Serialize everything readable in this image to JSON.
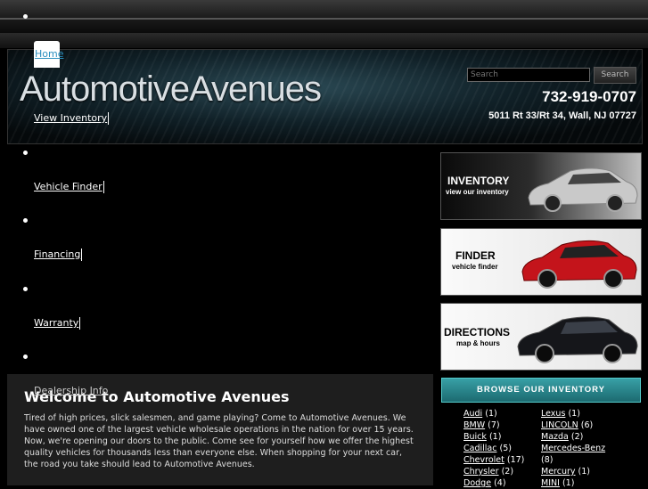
{
  "nav": {
    "items": [
      {
        "label": "Home"
      },
      {
        "label": "View Inventory"
      },
      {
        "label": "Vehicle Finder"
      },
      {
        "label": "Financing"
      },
      {
        "label": "Warranty"
      },
      {
        "label": "Dealership Info"
      }
    ]
  },
  "header": {
    "logo_text": "AutomotiveAvenues",
    "search_placeholder": "Search",
    "search_button": "Search",
    "phone": "732-919-0707",
    "address": "5011 Rt 33/Rt 34, Wall, NJ 07727"
  },
  "promos": {
    "inventory": {
      "title": "INVENTORY",
      "subtitle": "view our inventory",
      "icon": "silver-sedan-image"
    },
    "finder": {
      "title": "FINDER",
      "subtitle": "vehicle finder",
      "icon": "red-sedan-image"
    },
    "directions": {
      "title": "DIRECTIONS",
      "subtitle": "map & hours",
      "icon": "black-sedan-image"
    }
  },
  "browse": {
    "button": "BROWSE OUR INVENTORY",
    "left_makes": [
      {
        "name": "Audi",
        "count": "(1)"
      },
      {
        "name": "BMW",
        "count": "(7)"
      },
      {
        "name": "Buick",
        "count": "(1)"
      },
      {
        "name": "Cadillac",
        "count": "(5)"
      },
      {
        "name": "Chevrolet",
        "count": "(17)"
      },
      {
        "name": "Chrysler",
        "count": "(2)"
      },
      {
        "name": "Dodge",
        "count": "(4)"
      }
    ],
    "right_makes": [
      {
        "name": "Lexus",
        "count": "(1)"
      },
      {
        "name": "LINCOLN",
        "count": "(6)"
      },
      {
        "name": "Mazda",
        "count": "(2)"
      },
      {
        "name": "Mercedes-Benz",
        "count": "(8)"
      },
      {
        "name": "Mercury",
        "count": "(1)"
      },
      {
        "name": "MINI",
        "count": "(1)"
      }
    ]
  },
  "content": {
    "heading": "Welcome to Automotive Avenues",
    "body": "Tired of high prices, slick salesmen, and game playing? Come to Automotive Avenues. We have owned one of the largest vehicle wholesale operations in the nation for over 15 years. Now, we're opening our doors to the public. Come see for yourself how we offer the highest quality vehicles for thousands less than everyone else. When shopping for your next car, the road you take should lead to Automotive Avenues."
  },
  "colors": {
    "accent": "#2a8fbf",
    "browse_button": "#2a8a90",
    "background": "#000000",
    "content_panel": "#1e1e1e"
  }
}
